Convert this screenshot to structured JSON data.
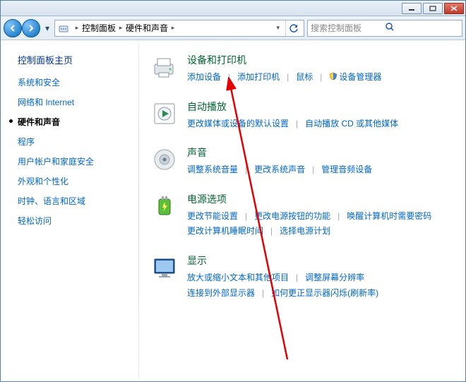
{
  "titlebar": {},
  "breadcrumb": {
    "root": "控制面板",
    "current": "硬件和声音"
  },
  "search": {
    "placeholder": "搜索控制面板"
  },
  "sidebar": {
    "title": "控制面板主页",
    "items": [
      {
        "label": "系统和安全"
      },
      {
        "label": "网络和 Internet"
      },
      {
        "label": "硬件和声音",
        "current": true
      },
      {
        "label": "程序"
      },
      {
        "label": "用户帐户和家庭安全"
      },
      {
        "label": "外观和个性化"
      },
      {
        "label": "时钟、语言和区域"
      },
      {
        "label": "轻松访问"
      }
    ]
  },
  "sections": [
    {
      "icon": "devices-printers",
      "title": "设备和打印机",
      "rows": [
        [
          {
            "text": "添加设备"
          },
          {
            "sep": true
          },
          {
            "text": "添加打印机"
          },
          {
            "sep": true
          },
          {
            "text": "鼠标"
          },
          {
            "sep": true
          },
          {
            "shield": true,
            "text": "设备管理器"
          }
        ]
      ]
    },
    {
      "icon": "autoplay",
      "title": "自动播放",
      "rows": [
        [
          {
            "text": "更改媒体或设备的默认设置"
          },
          {
            "sep": true
          },
          {
            "text": "自动播放 CD 或其他媒体"
          }
        ]
      ]
    },
    {
      "icon": "sound",
      "title": "声音",
      "rows": [
        [
          {
            "text": "调整系统音量"
          },
          {
            "sep": true
          },
          {
            "text": "更改系统声音"
          },
          {
            "sep": true
          },
          {
            "text": "管理音频设备"
          }
        ]
      ]
    },
    {
      "icon": "power",
      "title": "电源选项",
      "rows": [
        [
          {
            "text": "更改节能设置"
          },
          {
            "sep": true
          },
          {
            "text": "更改电源按钮的功能"
          },
          {
            "sep": true
          },
          {
            "text": "唤醒计算机时需要密码"
          }
        ],
        [
          {
            "text": "更改计算机睡眠时间"
          },
          {
            "sep": true
          },
          {
            "text": "选择电源计划"
          }
        ]
      ]
    },
    {
      "icon": "display",
      "title": "显示",
      "rows": [
        [
          {
            "text": "放大或缩小文本和其他项目"
          },
          {
            "sep": true
          },
          {
            "text": "调整屏幕分辨率"
          }
        ],
        [
          {
            "text": "连接到外部显示器"
          },
          {
            "sep": true
          },
          {
            "text": "如何更正显示器闪烁(刷新率)"
          }
        ]
      ]
    }
  ]
}
